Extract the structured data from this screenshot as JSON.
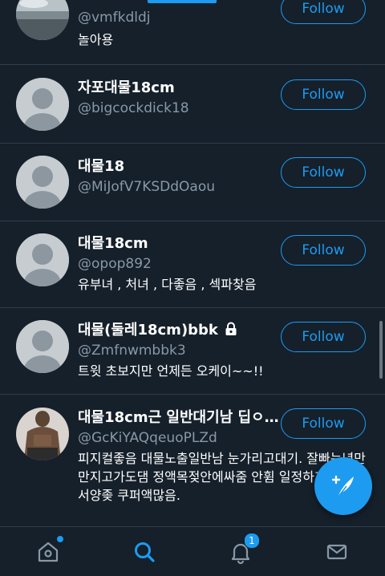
{
  "follow_label": "Follow",
  "users": [
    {
      "display_name": "",
      "handle": "@vmfkdldj",
      "bio": "놀아용",
      "locked": false
    },
    {
      "display_name": "자포대물18cm",
      "handle": "@bigcockdick18",
      "bio": "",
      "locked": false
    },
    {
      "display_name": "대물18",
      "handle": "@MiJofV7KSDdOaou",
      "bio": "",
      "locked": false
    },
    {
      "display_name": "대물18cm",
      "handle": "@opop892",
      "bio": "유부녀 , 처녀 , 다좋음 , 섹파찾음",
      "locked": false
    },
    {
      "display_name": "대물(둘레18cm)bbk",
      "handle": "@Zmfnwmbbk3",
      "bio": "트윗 초보지만 언제든 오케이~~!!",
      "locked": true
    },
    {
      "display_name": "대물18cm근 일반대기남 딥ㅇ…",
      "handle": "@GcKiYAQqeuoPLZd",
      "bio": "피지컬좋음 대물노출일반남 눈가리고대기. 잘빠는년만 만지고가도댐 정액목젖안에싸줌 안휨 일정하게두꺼움 서양좆 쿠퍼액많음.",
      "locked": false
    }
  ],
  "tabbar": {
    "notifications_count": "1"
  },
  "colors": {
    "background": "#15202b",
    "accent": "#1d9bf0",
    "secondary_text": "#8899a6"
  }
}
